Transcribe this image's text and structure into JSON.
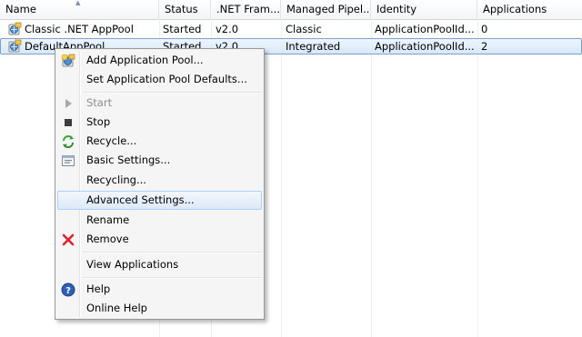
{
  "columns": [
    {
      "label": "Name"
    },
    {
      "label": "Status"
    },
    {
      "label": ".NET Fram..."
    },
    {
      "label": "Managed Pipel..."
    },
    {
      "label": "Identity"
    },
    {
      "label": "Applications"
    }
  ],
  "rows": [
    {
      "icon": "app-pool-icon",
      "name": "Classic .NET AppPool",
      "status": "Started",
      "net": "v2.0",
      "pipeline": "Classic",
      "identity": "ApplicationPoolId...",
      "apps": "0"
    },
    {
      "icon": "app-pool-icon",
      "name": "DefaultAppPool",
      "status": "Started",
      "net": "v2.0",
      "pipeline": "Integrated",
      "identity": "ApplicationPoolId...",
      "apps": "2"
    }
  ],
  "menu": {
    "items": [
      {
        "label": "Add Application Pool...",
        "icon": "add-app-pool-icon"
      },
      {
        "label": "Set Application Pool Defaults..."
      },
      {
        "label": "Start",
        "icon": "start-icon",
        "disabled": true
      },
      {
        "label": "Stop",
        "icon": "stop-icon"
      },
      {
        "label": "Recycle...",
        "icon": "recycle-icon"
      },
      {
        "label": "Basic Settings...",
        "icon": "basic-settings-icon"
      },
      {
        "label": "Recycling..."
      },
      {
        "label": "Advanced Settings...",
        "highlighted": true
      },
      {
        "label": "Rename"
      },
      {
        "label": "Remove",
        "icon": "remove-icon"
      },
      {
        "label": "View Applications"
      },
      {
        "label": "Help",
        "icon": "help-icon"
      },
      {
        "label": "Online Help"
      }
    ]
  },
  "colors": {
    "selection_border": "#7da2ce",
    "menu_highlight_border": "#aecff7",
    "remove_red": "#d9232d",
    "help_blue": "#2d5fb8",
    "recycle_green": "#3aa33a"
  }
}
